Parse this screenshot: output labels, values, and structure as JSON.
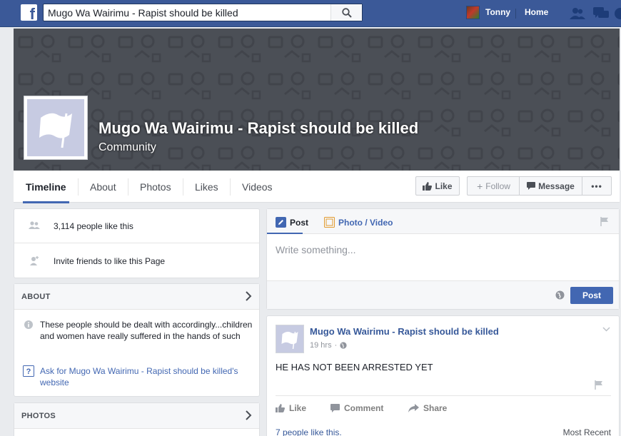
{
  "topbar": {
    "search_value": "Mugo Wa Wairimu - Rapist should be killed",
    "user_name": "Tonny",
    "home_label": "Home"
  },
  "page": {
    "title": "Mugo Wa Wairimu - Rapist should be killed",
    "category": "Community"
  },
  "tabs": [
    "Timeline",
    "About",
    "Photos",
    "Likes",
    "Videos"
  ],
  "actions": {
    "like": "Like",
    "follow": "Follow",
    "message": "Message",
    "more": "•••"
  },
  "sidebar": {
    "likes_count": "3,114 people like this",
    "invite": "Invite friends to like this Page",
    "about_header": "ABOUT",
    "about_text": "These people should be dealt with accordingly...children and women have really suffered in the hands of such",
    "website_link": "Ask for Mugo Wa Wairimu - Rapist should be killed's website",
    "photos_header": "PHOTOS"
  },
  "composer": {
    "tab_post": "Post",
    "tab_photo": "Photo / Video",
    "placeholder": "Write something...",
    "post_button": "Post"
  },
  "story": {
    "author": "Mugo Wa Wairimu - Rapist should be killed",
    "time": "19 hrs",
    "text": "HE HAS NOT BEEN ARRESTED YET",
    "like": "Like",
    "comment": "Comment",
    "share": "Share",
    "likes_summary": "7 people like this.",
    "most_recent": "Most Recent"
  },
  "colors": {
    "brand": "#3b5998",
    "link": "#4267b2",
    "cover": "#4b4f56"
  }
}
